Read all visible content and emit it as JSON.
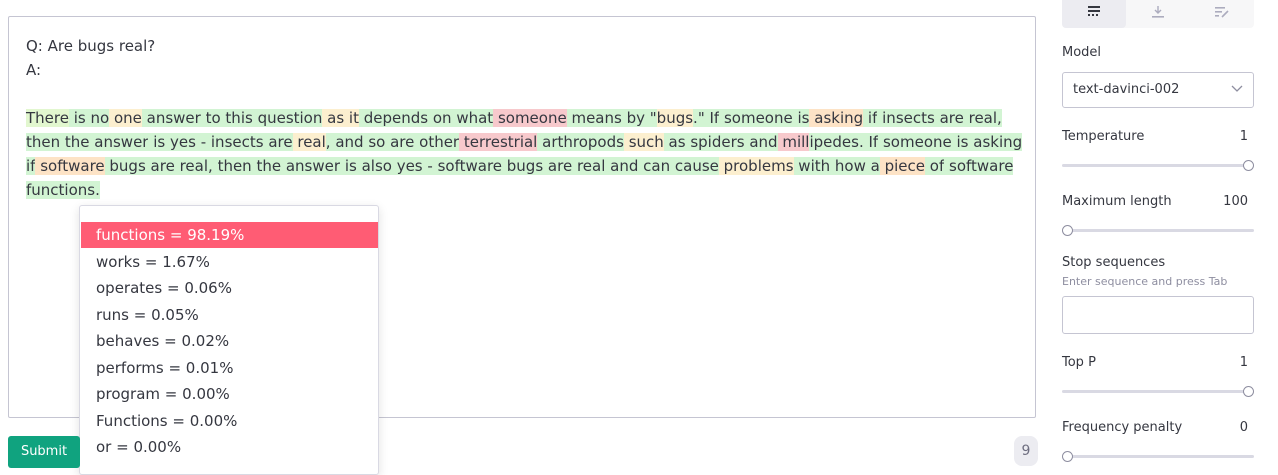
{
  "prompt": {
    "line1": "Q: Are bugs real?",
    "line2": "A:"
  },
  "completion_tokens": [
    {
      "t": "There",
      "c": "g2"
    },
    {
      "t": " is",
      "c": "g"
    },
    {
      "t": " no",
      "c": "g"
    },
    {
      "t": " one",
      "c": "y"
    },
    {
      "t": " answer",
      "c": "g"
    },
    {
      "t": " to",
      "c": "g"
    },
    {
      "t": " this",
      "c": "g"
    },
    {
      "t": " question",
      "c": "g"
    },
    {
      "t": " as",
      "c": "y"
    },
    {
      "t": " it",
      "c": "y"
    },
    {
      "t": " depends",
      "c": "g"
    },
    {
      "t": " on",
      "c": "g"
    },
    {
      "t": " what",
      "c": "g"
    },
    {
      "t": " someone",
      "c": "r"
    },
    {
      "t": " means",
      "c": "g"
    },
    {
      "t": " by",
      "c": "g"
    },
    {
      "t": " \"",
      "c": "g"
    },
    {
      "t": "bugs",
      "c": "y"
    },
    {
      "t": ".\"",
      "c": "g"
    },
    {
      "t": " If",
      "c": "g"
    },
    {
      "t": " someone",
      "c": "g"
    },
    {
      "t": " is",
      "c": "g"
    },
    {
      "t": " asking",
      "c": "o"
    },
    {
      "t": " if",
      "c": "g"
    },
    {
      "t": " insects",
      "c": "g"
    },
    {
      "t": " are",
      "c": "g"
    },
    {
      "t": " real",
      "c": "g"
    },
    {
      "t": ",",
      "c": "g"
    },
    {
      "t": " then",
      "c": "g"
    },
    {
      "t": " the",
      "c": "g"
    },
    {
      "t": " answer",
      "c": "g"
    },
    {
      "t": " is",
      "c": "g"
    },
    {
      "t": " yes",
      "c": "g"
    },
    {
      "t": " -",
      "c": "g"
    },
    {
      "t": " insects",
      "c": "g"
    },
    {
      "t": " are",
      "c": "g"
    },
    {
      "t": " real",
      "c": "y"
    },
    {
      "t": ",",
      "c": "g"
    },
    {
      "t": " and",
      "c": "g"
    },
    {
      "t": " so",
      "c": "g"
    },
    {
      "t": " are",
      "c": "g"
    },
    {
      "t": " other",
      "c": "g"
    },
    {
      "t": " terrestrial",
      "c": "r"
    },
    {
      "t": " arthropods",
      "c": "g"
    },
    {
      "t": " such",
      "c": "y"
    },
    {
      "t": " as",
      "c": "g"
    },
    {
      "t": " spiders",
      "c": "g"
    },
    {
      "t": " and",
      "c": "g"
    },
    {
      "t": " mill",
      "c": "r"
    },
    {
      "t": "ipedes",
      "c": "g"
    },
    {
      "t": ".",
      "c": "g"
    },
    {
      "t": " If",
      "c": "g"
    },
    {
      "t": " someone",
      "c": "g"
    },
    {
      "t": " is",
      "c": "g"
    },
    {
      "t": " asking",
      "c": "g"
    },
    {
      "t": " if",
      "c": "g"
    },
    {
      "t": " software",
      "c": "o"
    },
    {
      "t": " bugs",
      "c": "g"
    },
    {
      "t": " are",
      "c": "g"
    },
    {
      "t": " real",
      "c": "g"
    },
    {
      "t": ",",
      "c": "g"
    },
    {
      "t": " then",
      "c": "g"
    },
    {
      "t": " the",
      "c": "g"
    },
    {
      "t": " answer",
      "c": "g"
    },
    {
      "t": " is",
      "c": "g"
    },
    {
      "t": " also",
      "c": "g"
    },
    {
      "t": " yes",
      "c": "g"
    },
    {
      "t": " -",
      "c": "g"
    },
    {
      "t": " software",
      "c": "g"
    },
    {
      "t": " bugs",
      "c": "g"
    },
    {
      "t": " are",
      "c": "g"
    },
    {
      "t": " real",
      "c": "g"
    },
    {
      "t": " and",
      "c": "g"
    },
    {
      "t": " can",
      "c": "g"
    },
    {
      "t": " cause",
      "c": "g"
    },
    {
      "t": " problems",
      "c": "y"
    },
    {
      "t": " with",
      "c": "g"
    },
    {
      "t": " how",
      "c": "g"
    },
    {
      "t": " a",
      "c": "g"
    },
    {
      "t": " piece",
      "c": "o"
    },
    {
      "t": " of",
      "c": "g"
    },
    {
      "t": " software",
      "c": "g"
    },
    {
      "t": " functions",
      "c": "g"
    },
    {
      "t": ".",
      "c": "g"
    }
  ],
  "probabilities": {
    "selected_index": 0,
    "items": [
      "functions = 98.19%",
      "works = 1.67%",
      "operates = 0.06%",
      "runs = 0.05%",
      "behaves = 0.02%",
      "performs = 0.01%",
      "program = 0.00%",
      "Functions = 0.00%",
      "or = 0.00%"
    ]
  },
  "footer": {
    "submit_label": "Submit",
    "token_count": "9"
  },
  "sidebar": {
    "model_label": "Model",
    "model_value": "text-davinci-002",
    "temperature_label": "Temperature",
    "temperature_value": "1",
    "max_length_label": "Maximum length",
    "max_length_value": "100",
    "stop_label": "Stop sequences",
    "stop_hint": "Enter sequence and press Tab",
    "top_p_label": "Top P",
    "top_p_value": "1",
    "freq_label": "Frequency penalty",
    "freq_value": "0"
  },
  "sliders": {
    "temperature_fraction": 1.0,
    "max_length_fraction": 0.0,
    "top_p_fraction": 1.0,
    "frequency_fraction": 0.0
  },
  "colors": {
    "accent": "#10a37f",
    "selected_prob": "#ff5c74",
    "high_prob": "#d2f4d3",
    "medium_prob": "#fcefcf",
    "low_prob": "#f7c9cc"
  },
  "icons": [
    "complete-mode-icon",
    "insert-mode-icon",
    "edit-mode-icon",
    "chevron-down-icon"
  ]
}
